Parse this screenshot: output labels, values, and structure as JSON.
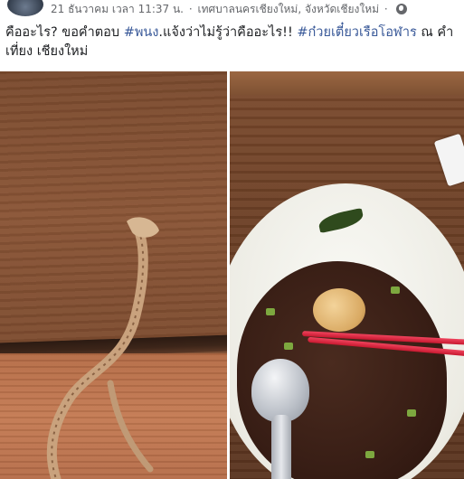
{
  "post": {
    "date": "21 ธันวาคม เวลา 11:37 น.",
    "separator": "·",
    "location": "เทศบาลนครเชียงใหม่, จังหวัดเชียงใหม่",
    "text_part1": "คืออะไร? ขอคำตอบ ",
    "hashtag1": "#พนง",
    "text_part2": ".แจ้งว่าไม่รู้ว่าคืออะไร!! ",
    "hashtag2": "#ก๋วยเตี๋ยวเรือโอฬาร",
    "text_part3": " ณ คำเที่ยง เชียงใหม่"
  },
  "icons": {
    "privacy": "globe-icon"
  },
  "colors": {
    "hashtag": "#385898",
    "meta": "#65676b",
    "text": "#1c1e21"
  }
}
